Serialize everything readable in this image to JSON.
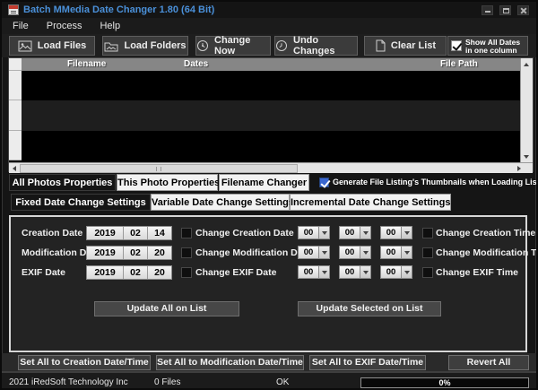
{
  "window": {
    "title": "Batch MMedia Date Changer 1.80 (64 Bit)"
  },
  "menu": {
    "items": [
      "File",
      "Process",
      "Help"
    ]
  },
  "toolbar": {
    "load_files": "Load Files",
    "load_folders": "Load Folders",
    "change_now": "Change Now",
    "undo_changes": "Undo Changes",
    "clear_list": "Clear List",
    "show_all_dates": {
      "label": "Show All Dates in one column",
      "checked": true
    }
  },
  "file_list": {
    "columns": [
      "Filename",
      "Dates",
      "File Path"
    ],
    "rows": []
  },
  "property_tabs": {
    "items": [
      {
        "label": "All Photos Properties",
        "active": true
      },
      {
        "label": "This Photo Properties",
        "active": false
      },
      {
        "label": "Filename Changer",
        "active": false
      }
    ]
  },
  "thumbnail_checkbox": {
    "label": "Generate File Listing's Thumbnails when Loading List",
    "checked": true
  },
  "settings_tabs": {
    "items": [
      {
        "label": "Fixed Date Change Settings",
        "active": true
      },
      {
        "label": "Variable Date Change Settings",
        "active": false
      },
      {
        "label": "Incremental Date Change Settings",
        "active": false
      }
    ]
  },
  "fixed_settings": {
    "rows": [
      {
        "label": "Creation Date",
        "year": "2019",
        "month": "02",
        "day": "14",
        "date_check_label": "Change Creation Date",
        "date_checked": false,
        "hh": "00",
        "mm": "00",
        "ss": "00",
        "time_check_label": "Change Creation Time",
        "time_checked": false
      },
      {
        "label": "Modification Date",
        "year": "2019",
        "month": "02",
        "day": "20",
        "date_check_label": "Change Modification Date",
        "date_checked": false,
        "hh": "00",
        "mm": "00",
        "ss": "00",
        "time_check_label": "Change Modification Time",
        "time_checked": false
      },
      {
        "label": "EXIF Date",
        "year": "2019",
        "month": "02",
        "day": "20",
        "date_check_label": "Change EXIF Date",
        "date_checked": false,
        "hh": "00",
        "mm": "00",
        "ss": "00",
        "time_check_label": "Change EXIF Time",
        "time_checked": false
      }
    ],
    "update_all_label": "Update All on List",
    "update_selected_label": "Update Selected on List"
  },
  "bottom_buttons": [
    "Set All to Creation Date/Time",
    "Set All to Modification Date/Time",
    "Set All to EXIF Date/Time",
    "Revert All"
  ],
  "status_bar": {
    "copyright": "2021 iRedSoft Technology Inc",
    "file_count": "0 Files",
    "status": "OK",
    "progress_label": "0%",
    "progress_percent": 0
  },
  "colors": {
    "title_text": "#4a90d9",
    "checkbox_blue": "#3a67cf",
    "list_header": "#868686",
    "row_alt": "#1e1e1e"
  }
}
